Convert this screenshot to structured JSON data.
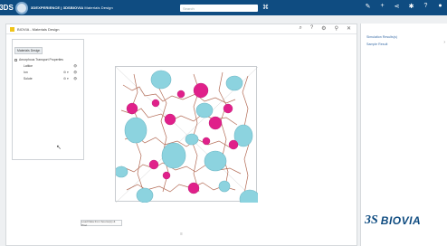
{
  "topbar": {
    "ds_logo": "3DS",
    "title_prefix": "3DEXPERIENCE | 3DSBIOVIA",
    "title_rest": "Materials Design",
    "search_placeholder": "Search",
    "tag_icon": "tag-icon",
    "right_icons": [
      "chat-icon",
      "add-icon",
      "share-icon",
      "compass-icon",
      "help-icon",
      "user-icon"
    ]
  },
  "window": {
    "title": "BIOVIA - Materials Design",
    "tools": [
      "search-icon",
      "help-icon",
      "settings-icon",
      "pin-icon",
      "close-icon"
    ],
    "footer_glyph": "≡",
    "bottom_button": "Load Data from Source(s) & Proc"
  },
  "tree": {
    "tab": "Materials Design",
    "root": "Amorphous Transport Properties",
    "items": [
      {
        "label": "Lattice",
        "controls": "",
        "eye": "👁"
      },
      {
        "label": "Ion",
        "controls": "⚙ ▾",
        "eye": "👁"
      },
      {
        "label": "Solute",
        "controls": "⚙ ▾",
        "eye": "👁"
      }
    ]
  },
  "right_panel": {
    "header": "Simulation Results(s)",
    "subtext": "Sample Result"
  },
  "brand": {
    "ds": "3S",
    "name": "BIOVIA"
  },
  "colors": {
    "topbar": "#0f4c81",
    "cyan": "#8cd3df",
    "magenta": "#e0208a",
    "link": "#3c6ea8"
  }
}
